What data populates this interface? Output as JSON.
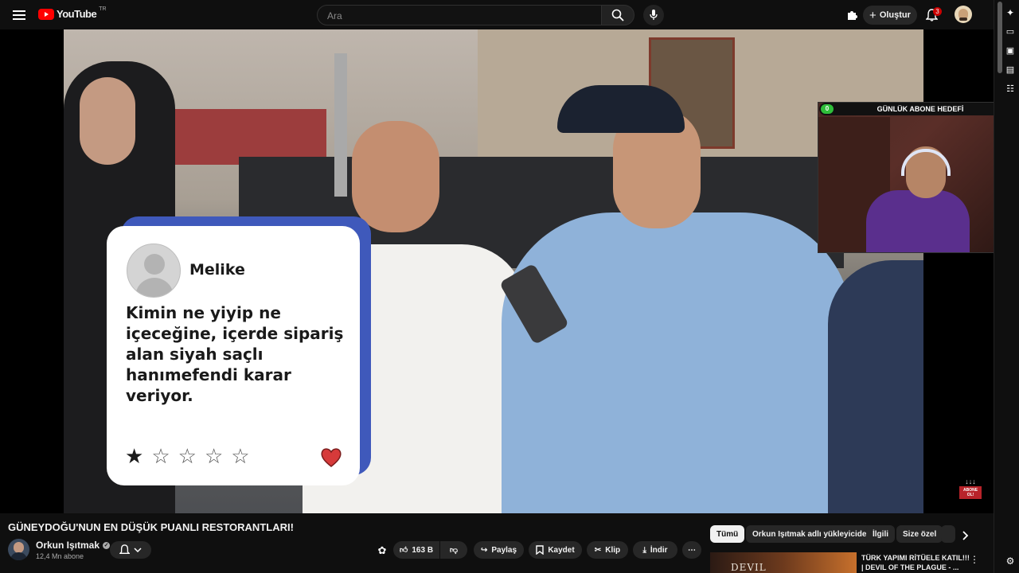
{
  "topbar": {
    "logo_text": "YouTube",
    "logo_country": "TR",
    "search_placeholder": "Ara",
    "create_label": "Oluştur",
    "notification_count": "3"
  },
  "overlay": {
    "reviewer_name": "Melike",
    "review_text": "Kimin ne yiyip ne içeceğine, içerde sipariş alan siyah saçlı hanımefendi karar veriyor.",
    "rating": 1,
    "rating_max": 5,
    "subscribe_badge": "ABONE OL!"
  },
  "webcam": {
    "goal_title": "GÜNLÜK ABONE HEDEFİ",
    "goal_current": "0",
    "goal_target": "6"
  },
  "video_info": {
    "title": "GÜNEYDOĞU'NUN EN DÜŞÜK PUANLI RESTORANTLARI!",
    "channel_name": "Orkun Işıtmak",
    "subscribers": "12,4 Mn abone",
    "like_count": "163 B",
    "share_label": "Paylaş",
    "save_label": "Kaydet",
    "clip_label": "Klip",
    "download_label": "İndir"
  },
  "related": {
    "chips": [
      "Tümü",
      "Orkun Işıtmak adlı yükleyiciden",
      "İlgili",
      "Size özel"
    ],
    "first_video_title_1": "TÜRK YAPIMI RİTÜELE KATIL!!!",
    "first_video_title_2": "| DEVIL OF THE PLAGUE - ..."
  },
  "colors": {
    "brand_red": "#ff0000",
    "card_blue": "#3f59bb",
    "heart_red": "#d63a3a",
    "chip_active_bg": "#f1f1f1"
  }
}
